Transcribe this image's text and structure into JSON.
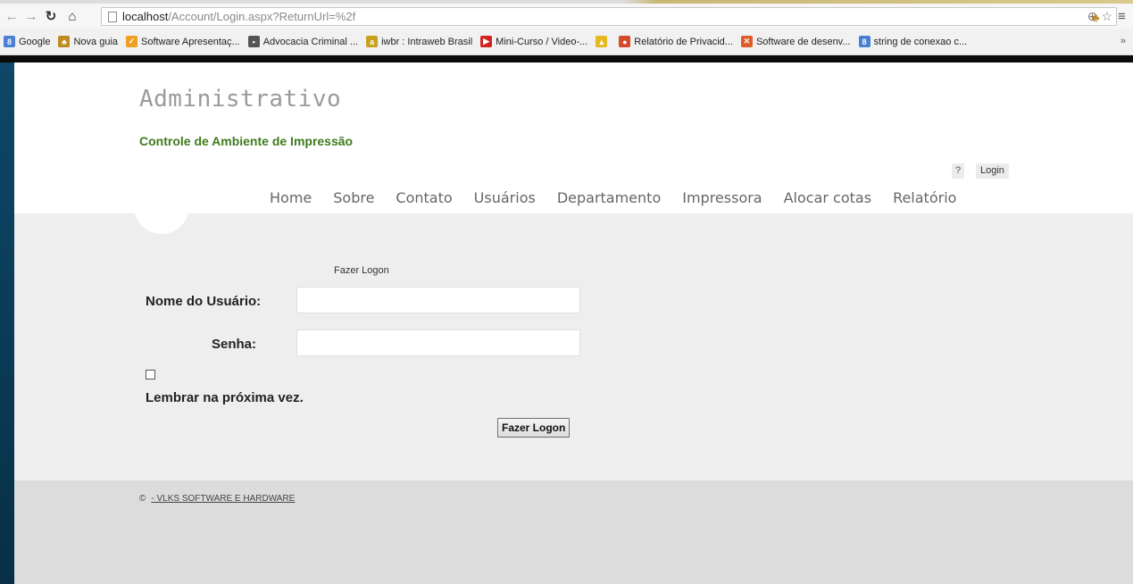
{
  "browser": {
    "url_host": "localhost",
    "url_path": "/Account/Login.aspx?ReturnUrl=%2f",
    "bookmarks": [
      {
        "label": "Google",
        "icon": "google-icon",
        "color": "#4a7fd4",
        "glyph": "8"
      },
      {
        "label": "Nova guia",
        "icon": "chrome-apps-icon",
        "color": "#c08a1e",
        "glyph": "♣"
      },
      {
        "label": "Software Apresentaç...",
        "icon": "orange-check-icon",
        "color": "#f0a020",
        "glyph": "✓"
      },
      {
        "label": "Advocacia Criminal ...",
        "icon": "page-dark-icon",
        "color": "#555555",
        "glyph": "▪"
      },
      {
        "label": "iwbr : Intraweb Brasil",
        "icon": "iwbr-icon",
        "color": "#c8a020",
        "glyph": "a"
      },
      {
        "label": "Mini-Curso / Video-...",
        "icon": "youtube-icon",
        "color": "#d22222",
        "glyph": "▶"
      },
      {
        "label": "",
        "icon": "drive-icon",
        "color": "#e6b820",
        "glyph": "▲"
      },
      {
        "label": "Relatório de Privacid...",
        "icon": "chrome-icon",
        "color": "#d44a2a",
        "glyph": "●"
      },
      {
        "label": "Software de desenv...",
        "icon": "vs-icon",
        "color": "#e05a2a",
        "glyph": "✕"
      },
      {
        "label": "string de conexao c...",
        "icon": "google-icon",
        "color": "#4a7fd4",
        "glyph": "8"
      }
    ],
    "overflow": "»"
  },
  "header": {
    "title": "Administrativo",
    "subtitle": "Controle de Ambiente de Impressão",
    "help": "?",
    "login": "Login",
    "menu": [
      "Home",
      "Sobre",
      "Contato",
      "Usuários",
      "Departamento",
      "Impressora",
      "Alocar cotas",
      "Relatório"
    ]
  },
  "login_form": {
    "title": "Fazer Logon",
    "username_label": "Nome do Usuário:",
    "username_value": "",
    "password_label": "Senha:",
    "password_value": "",
    "remember_label": "Lembrar na próxima vez.",
    "submit_label": "Fazer Logon"
  },
  "footer": {
    "copyright_symbol": "©",
    "company": "- VLKS SOFTWARE E HARDWARE"
  },
  "colors": {
    "subtitle": "#3f7a1d",
    "desktop": "#0f4a6b"
  }
}
